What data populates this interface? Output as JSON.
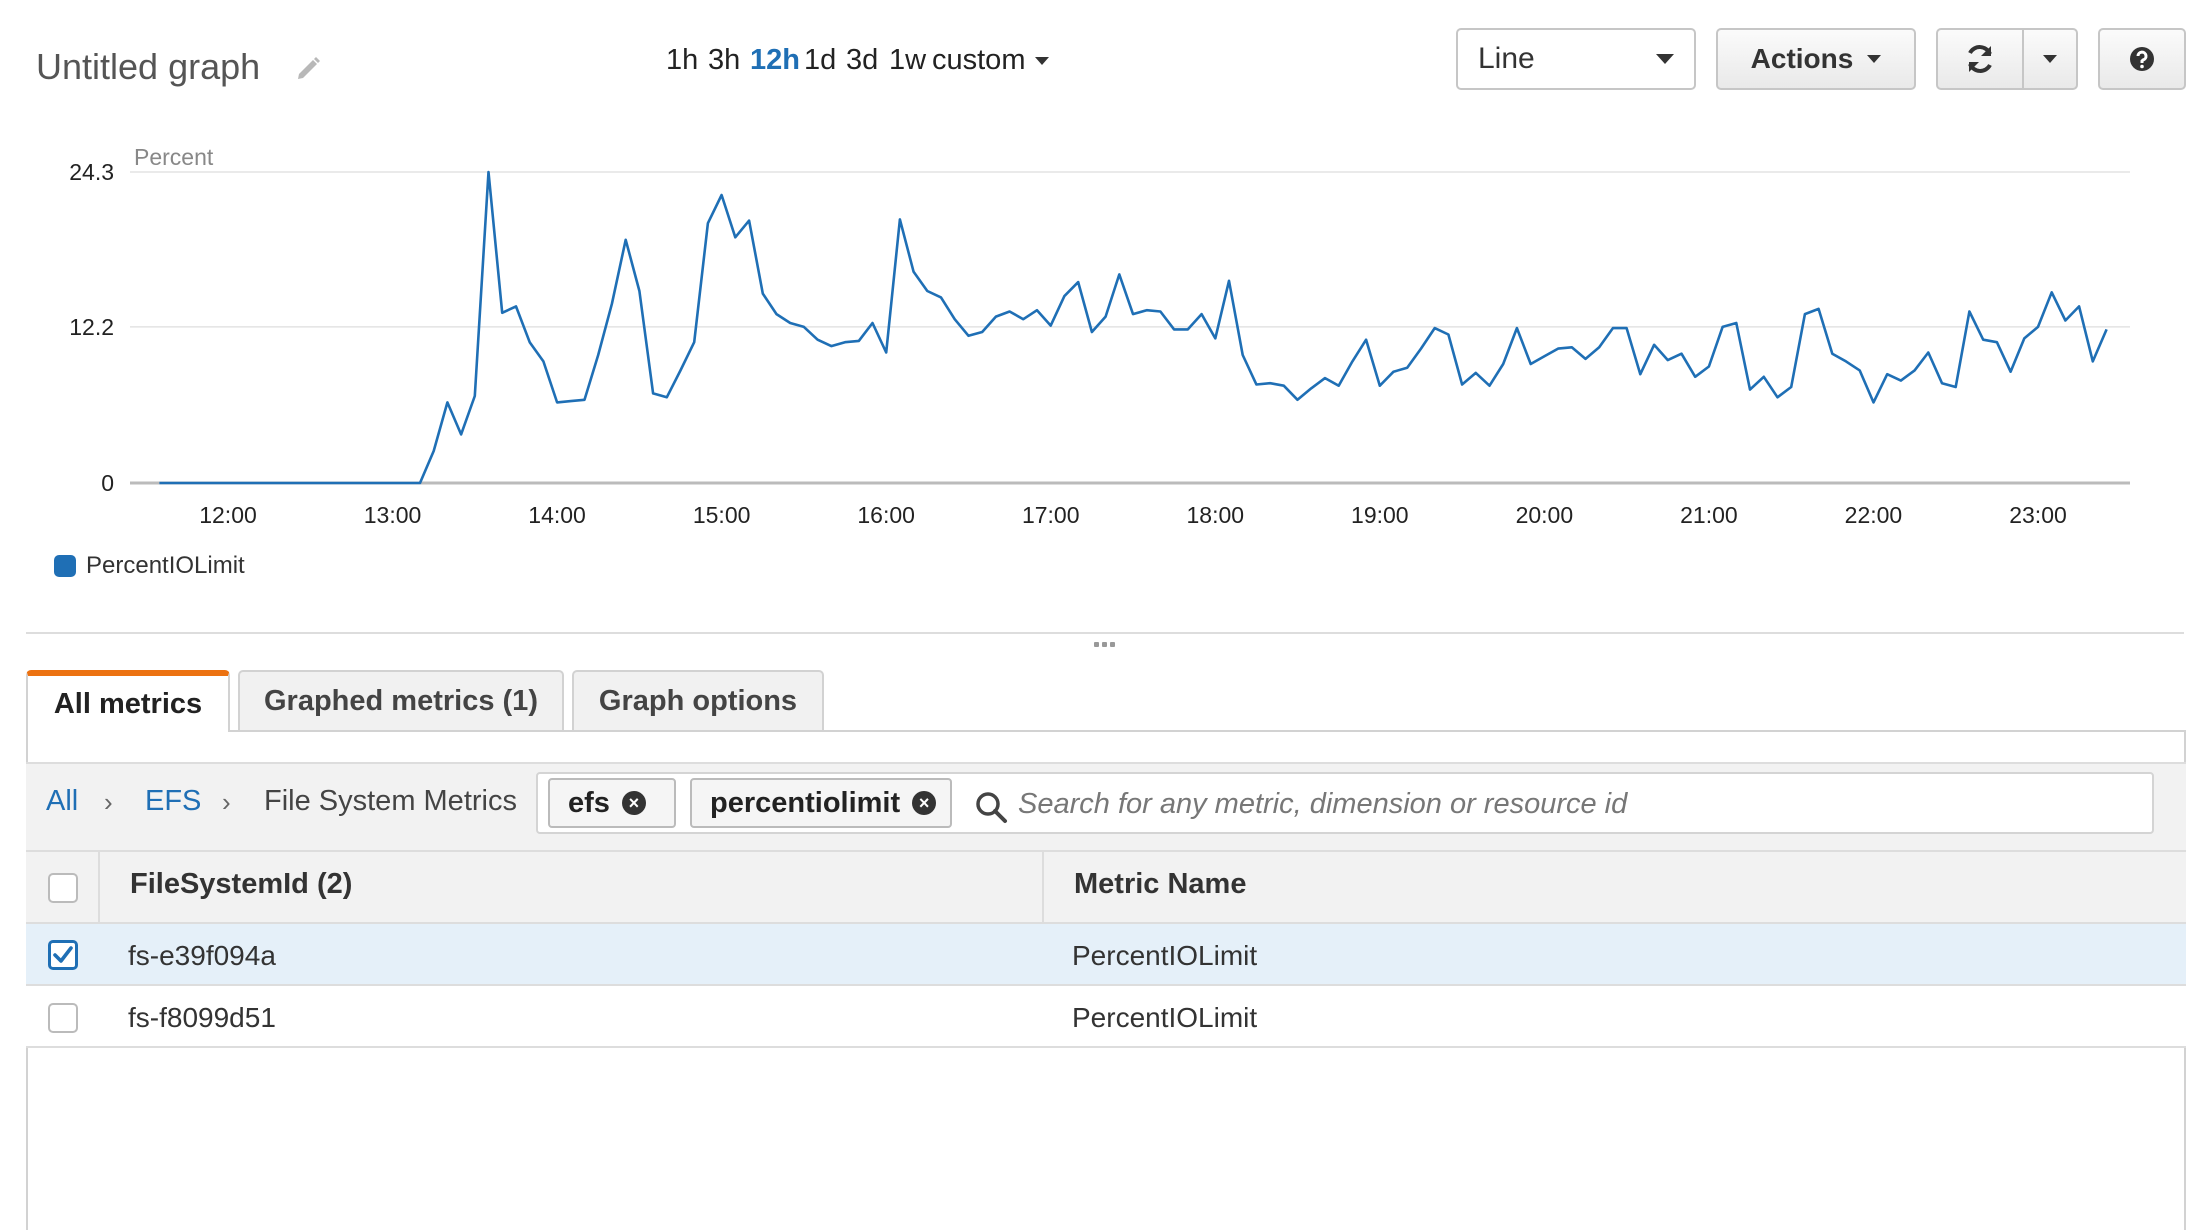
{
  "header": {
    "title": "Untitled graph",
    "ranges": [
      {
        "label": "1h",
        "active": false
      },
      {
        "label": "3h",
        "active": false
      },
      {
        "label": "12h",
        "active": true
      },
      {
        "label": "1d",
        "active": false
      },
      {
        "label": "3d",
        "active": false
      },
      {
        "label": "1w",
        "active": false
      }
    ],
    "custom_label": "custom",
    "graph_type": "Line",
    "actions_label": "Actions"
  },
  "chart_data": {
    "type": "line",
    "ylabel": "Percent",
    "ylim": [
      0,
      24.3
    ],
    "y_ticks": [
      "0",
      "12.2",
      "24.3"
    ],
    "x_ticks": [
      "12:00",
      "13:00",
      "14:00",
      "15:00",
      "16:00",
      "17:00",
      "18:00",
      "19:00",
      "20:00",
      "20:00",
      "21:00",
      "22:00",
      "23:00"
    ],
    "xlim": [
      "11:35",
      "23:25"
    ],
    "grid": true,
    "legend_position": "bottom-left",
    "series": [
      {
        "name": "PercentIOLimit",
        "color": "#1f6fb5",
        "points": [
          [
            "11:35",
            0
          ],
          [
            "11:40",
            0
          ],
          [
            "11:45",
            0
          ],
          [
            "11:50",
            0
          ],
          [
            "11:55",
            0
          ],
          [
            "12:00",
            0
          ],
          [
            "12:05",
            0
          ],
          [
            "12:10",
            0
          ],
          [
            "12:15",
            0
          ],
          [
            "12:20",
            0
          ],
          [
            "12:25",
            0
          ],
          [
            "12:30",
            0
          ],
          [
            "12:35",
            0
          ],
          [
            "12:40",
            0
          ],
          [
            "12:45",
            0
          ],
          [
            "12:50",
            0
          ],
          [
            "12:55",
            0
          ],
          [
            "13:00",
            0
          ],
          [
            "13:05",
            0
          ],
          [
            "13:10",
            0
          ],
          [
            "13:15",
            2.5
          ],
          [
            "13:20",
            6.3
          ],
          [
            "13:25",
            3.8
          ],
          [
            "13:30",
            6.8
          ],
          [
            "13:35",
            24.3
          ],
          [
            "13:40",
            13.3
          ],
          [
            "13:45",
            13.8
          ],
          [
            "13:50",
            11.0
          ],
          [
            "13:55",
            9.5
          ],
          [
            "14:00",
            6.3
          ],
          [
            "14:05",
            6.4
          ],
          [
            "14:10",
            6.5
          ],
          [
            "14:15",
            10.0
          ],
          [
            "14:20",
            14.0
          ],
          [
            "14:25",
            19.0
          ],
          [
            "14:30",
            15.0
          ],
          [
            "14:35",
            7.0
          ],
          [
            "14:40",
            6.7
          ],
          [
            "14:45",
            8.8
          ],
          [
            "14:50",
            11.0
          ],
          [
            "14:55",
            20.3
          ],
          [
            "15:00",
            22.5
          ],
          [
            "15:05",
            19.2
          ],
          [
            "15:10",
            20.5
          ],
          [
            "15:15",
            14.8
          ],
          [
            "15:20",
            13.2
          ],
          [
            "15:25",
            12.5
          ],
          [
            "15:30",
            12.2
          ],
          [
            "15:35",
            11.2
          ],
          [
            "15:40",
            10.7
          ],
          [
            "15:45",
            11.0
          ],
          [
            "15:50",
            11.1
          ],
          [
            "15:55",
            12.5
          ],
          [
            "16:00",
            10.2
          ],
          [
            "16:05",
            20.6
          ],
          [
            "16:10",
            16.5
          ],
          [
            "16:15",
            15.0
          ],
          [
            "16:20",
            14.5
          ],
          [
            "16:25",
            12.8
          ],
          [
            "16:30",
            11.5
          ],
          [
            "16:35",
            11.8
          ],
          [
            "16:40",
            13.0
          ],
          [
            "16:45",
            13.4
          ],
          [
            "16:50",
            12.8
          ],
          [
            "16:55",
            13.5
          ],
          [
            "17:00",
            12.3
          ],
          [
            "17:05",
            14.6
          ],
          [
            "17:10",
            15.7
          ],
          [
            "17:15",
            11.8
          ],
          [
            "17:20",
            13.0
          ],
          [
            "17:25",
            16.3
          ],
          [
            "17:30",
            13.2
          ],
          [
            "17:35",
            13.5
          ],
          [
            "17:40",
            13.4
          ],
          [
            "17:45",
            12.0
          ],
          [
            "17:50",
            12.0
          ],
          [
            "17:55",
            13.2
          ],
          [
            "18:00",
            11.3
          ],
          [
            "18:05",
            15.8
          ],
          [
            "18:10",
            10.0
          ],
          [
            "18:15",
            7.7
          ],
          [
            "18:20",
            7.8
          ],
          [
            "18:25",
            7.6
          ],
          [
            "18:30",
            6.5
          ],
          [
            "18:35",
            7.4
          ],
          [
            "18:40",
            8.2
          ],
          [
            "18:45",
            7.6
          ],
          [
            "18:50",
            9.5
          ],
          [
            "18:55",
            11.2
          ],
          [
            "19:00",
            7.6
          ],
          [
            "19:05",
            8.7
          ],
          [
            "19:10",
            9.0
          ],
          [
            "19:15",
            10.5
          ],
          [
            "19:20",
            12.1
          ],
          [
            "19:25",
            11.6
          ],
          [
            "19:30",
            7.7
          ],
          [
            "19:35",
            8.6
          ],
          [
            "19:40",
            7.6
          ],
          [
            "19:45",
            9.3
          ],
          [
            "19:50",
            12.1
          ],
          [
            "19:55",
            9.3
          ],
          [
            "20:00",
            9.9
          ],
          [
            "20:05",
            10.5
          ],
          [
            "20:10",
            10.6
          ],
          [
            "20:15",
            9.7
          ],
          [
            "20:20",
            10.6
          ],
          [
            "20:25",
            12.1
          ],
          [
            "20:30",
            12.1
          ],
          [
            "20:35",
            8.5
          ],
          [
            "20:40",
            10.8
          ],
          [
            "20:45",
            9.6
          ],
          [
            "20:50",
            10.1
          ],
          [
            "20:55",
            8.3
          ],
          [
            "21:00",
            9.1
          ],
          [
            "21:05",
            12.2
          ],
          [
            "21:10",
            12.5
          ],
          [
            "21:15",
            7.3
          ],
          [
            "21:20",
            8.3
          ],
          [
            "21:25",
            6.7
          ],
          [
            "21:30",
            7.5
          ],
          [
            "21:35",
            13.2
          ],
          [
            "21:40",
            13.6
          ],
          [
            "21:45",
            10.1
          ],
          [
            "21:50",
            9.5
          ],
          [
            "21:55",
            8.8
          ],
          [
            "22:00",
            6.3
          ],
          [
            "22:05",
            8.5
          ],
          [
            "22:10",
            8.0
          ],
          [
            "22:15",
            8.8
          ],
          [
            "22:20",
            10.2
          ],
          [
            "22:25",
            7.8
          ],
          [
            "22:30",
            7.5
          ],
          [
            "22:35",
            13.4
          ],
          [
            "22:40",
            11.2
          ],
          [
            "22:45",
            11.0
          ],
          [
            "22:50",
            8.7
          ],
          [
            "22:55",
            11.3
          ],
          [
            "23:00",
            12.2
          ],
          [
            "23:05",
            14.9
          ],
          [
            "23:10",
            12.7
          ],
          [
            "23:15",
            13.8
          ],
          [
            "23:20",
            9.5
          ],
          [
            "23:25",
            12.0
          ]
        ]
      }
    ]
  },
  "tabs": [
    {
      "label": "All metrics",
      "active": true
    },
    {
      "label": "Graphed metrics (1)",
      "active": false
    },
    {
      "label": "Graph options",
      "active": false
    }
  ],
  "breadcrumb": {
    "all": "All",
    "namespace": "EFS",
    "current": "File System Metrics",
    "separator": "›"
  },
  "search": {
    "tokens": [
      "efs",
      "percentiolimit"
    ],
    "remove_glyph": "×",
    "placeholder": "Search for any metric, dimension or resource id"
  },
  "table": {
    "headers": [
      "FileSystemId  (2)",
      "Metric Name"
    ],
    "rows": [
      {
        "id": "fs-e39f094a",
        "metric": "PercentIOLimit",
        "checked": true
      },
      {
        "id": "fs-f8099d51",
        "metric": "PercentIOLimit",
        "checked": false
      }
    ]
  }
}
